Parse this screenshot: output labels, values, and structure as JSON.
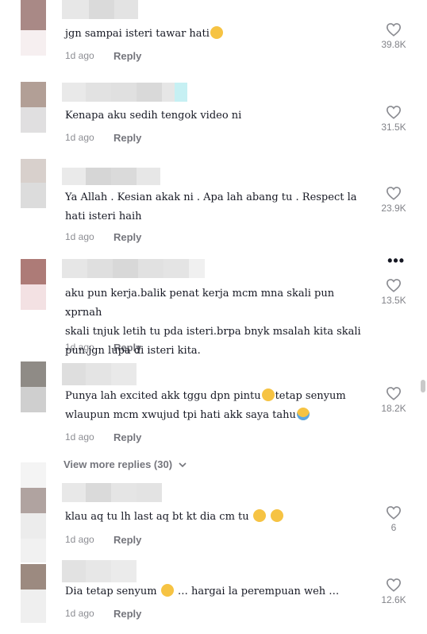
{
  "comments": [
    {
      "text": "jgn sampai isteri tawar hati",
      "emoji": "😑",
      "time": "1d ago",
      "reply": "Reply",
      "likes": "39.8K"
    },
    {
      "text": "Kenapa aku sedih tengok video ni",
      "time": "1d ago",
      "reply": "Reply",
      "likes": "31.5K"
    },
    {
      "text": "Ya Allah . Kesian akak ni . Apa lah abang tu . Respect la\nhati isteri haih",
      "time": "1d ago",
      "reply": "Reply",
      "likes": "23.9K"
    },
    {
      "text": "aku pun kerja.balik penat kerja mcm mna skali pun xprnah\nskali tnjuk letih tu pda isteri.brpa bnyk msalah kita skali\npun.jgn lupa di isteri kita.",
      "time": "1d ago",
      "reply": "Reply",
      "likes": "13.5K",
      "more": "•••"
    },
    {
      "text_a": "Punya lah excited akk tggu dpn pintu",
      "text_b": "tetap senyum\nwlaupun mcm xwujud tpi hati akk saya tahu",
      "emoji_a": "😥",
      "emoji_b": "😭",
      "time": "1d ago",
      "reply": "Reply",
      "likes": "18.2K"
    },
    {
      "text": "klau aq tu lh last aq bt kt dia cm tu",
      "emoji": "😏 😏",
      "time": "1d ago",
      "reply": "Reply",
      "likes": "6"
    },
    {
      "text_a": "Dia tetap senyum ",
      "text_b": "… hargai la perempuan weh …",
      "emoji": "😟",
      "time": "1d ago",
      "reply": "Reply",
      "likes": "12.6K"
    }
  ],
  "view_more": "View more replies (30)",
  "icons": {
    "heart": "heart-outline-icon",
    "chevron": "chevron-down-icon"
  },
  "colors": {
    "text": "#161823",
    "emoji": "#f6c343"
  }
}
